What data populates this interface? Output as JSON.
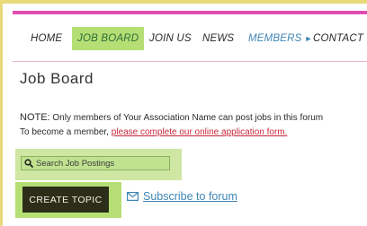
{
  "nav": {
    "items": [
      {
        "label": "HOME"
      },
      {
        "label": "JOB BOARD",
        "active": true
      },
      {
        "label": "JOIN US"
      },
      {
        "label": "NEWS"
      },
      {
        "label": "MEMBERS",
        "submenu": "chevron-right-icon"
      },
      {
        "label": "CONTACT"
      }
    ]
  },
  "page": {
    "title": "Job Board"
  },
  "note": {
    "label": "NOTE:",
    "line1": " Only members of Your Association Name can post jobs in this forum",
    "line2": "To become a member, ",
    "link": "please complete our online application form."
  },
  "search": {
    "placeholder": "Search Job Postings",
    "value": "",
    "icon": "search-icon"
  },
  "actions": {
    "create_label": "CREATE TOPIC",
    "subscribe_label": "Subscribe to forum",
    "subscribe_icon": "envelope-icon"
  },
  "colors": {
    "accent_stripe": "#e04db0",
    "highlight_green": "#b5df74",
    "link_blue": "#3f86b6",
    "link_red": "#c8283a",
    "button_dark": "#2c2e1a"
  }
}
